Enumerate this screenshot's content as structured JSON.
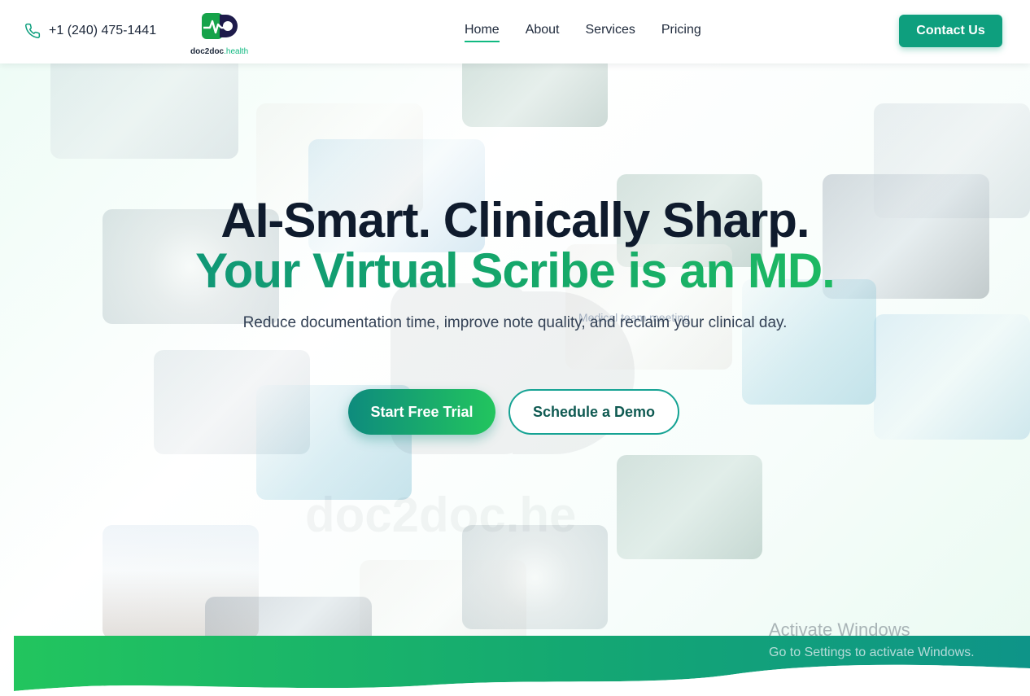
{
  "header": {
    "phone": "+1 (240) 475-1441",
    "phone_icon": "phone-icon",
    "logo": {
      "name": "doc2doc",
      "tld": ".health",
      "icon": "dd-heartbeat-logo"
    },
    "nav": [
      {
        "label": "Home",
        "active": true
      },
      {
        "label": "About",
        "active": false
      },
      {
        "label": "Services",
        "active": false
      },
      {
        "label": "Pricing",
        "active": false
      }
    ],
    "contact_label": "Contact Us"
  },
  "hero": {
    "headline": "AI-Smart. Clinically Sharp.",
    "subheadline": "Your Virtual Scribe is an MD.",
    "description": "Reduce documentation time, improve note quality, and reclaim your clinical day.",
    "primary_cta": "Start Free Trial",
    "secondary_cta": "Schedule a Demo",
    "image_alt": "Medical team meeting",
    "watermark": "doc2doc.he"
  },
  "system_overlay": {
    "title": "Activate Windows",
    "subtitle": "Go to Settings to activate Windows."
  },
  "colors": {
    "accent": "#0e9f7e",
    "accent_light": "#22c55e",
    "heading": "#0f1b2d",
    "text": "#334155"
  }
}
